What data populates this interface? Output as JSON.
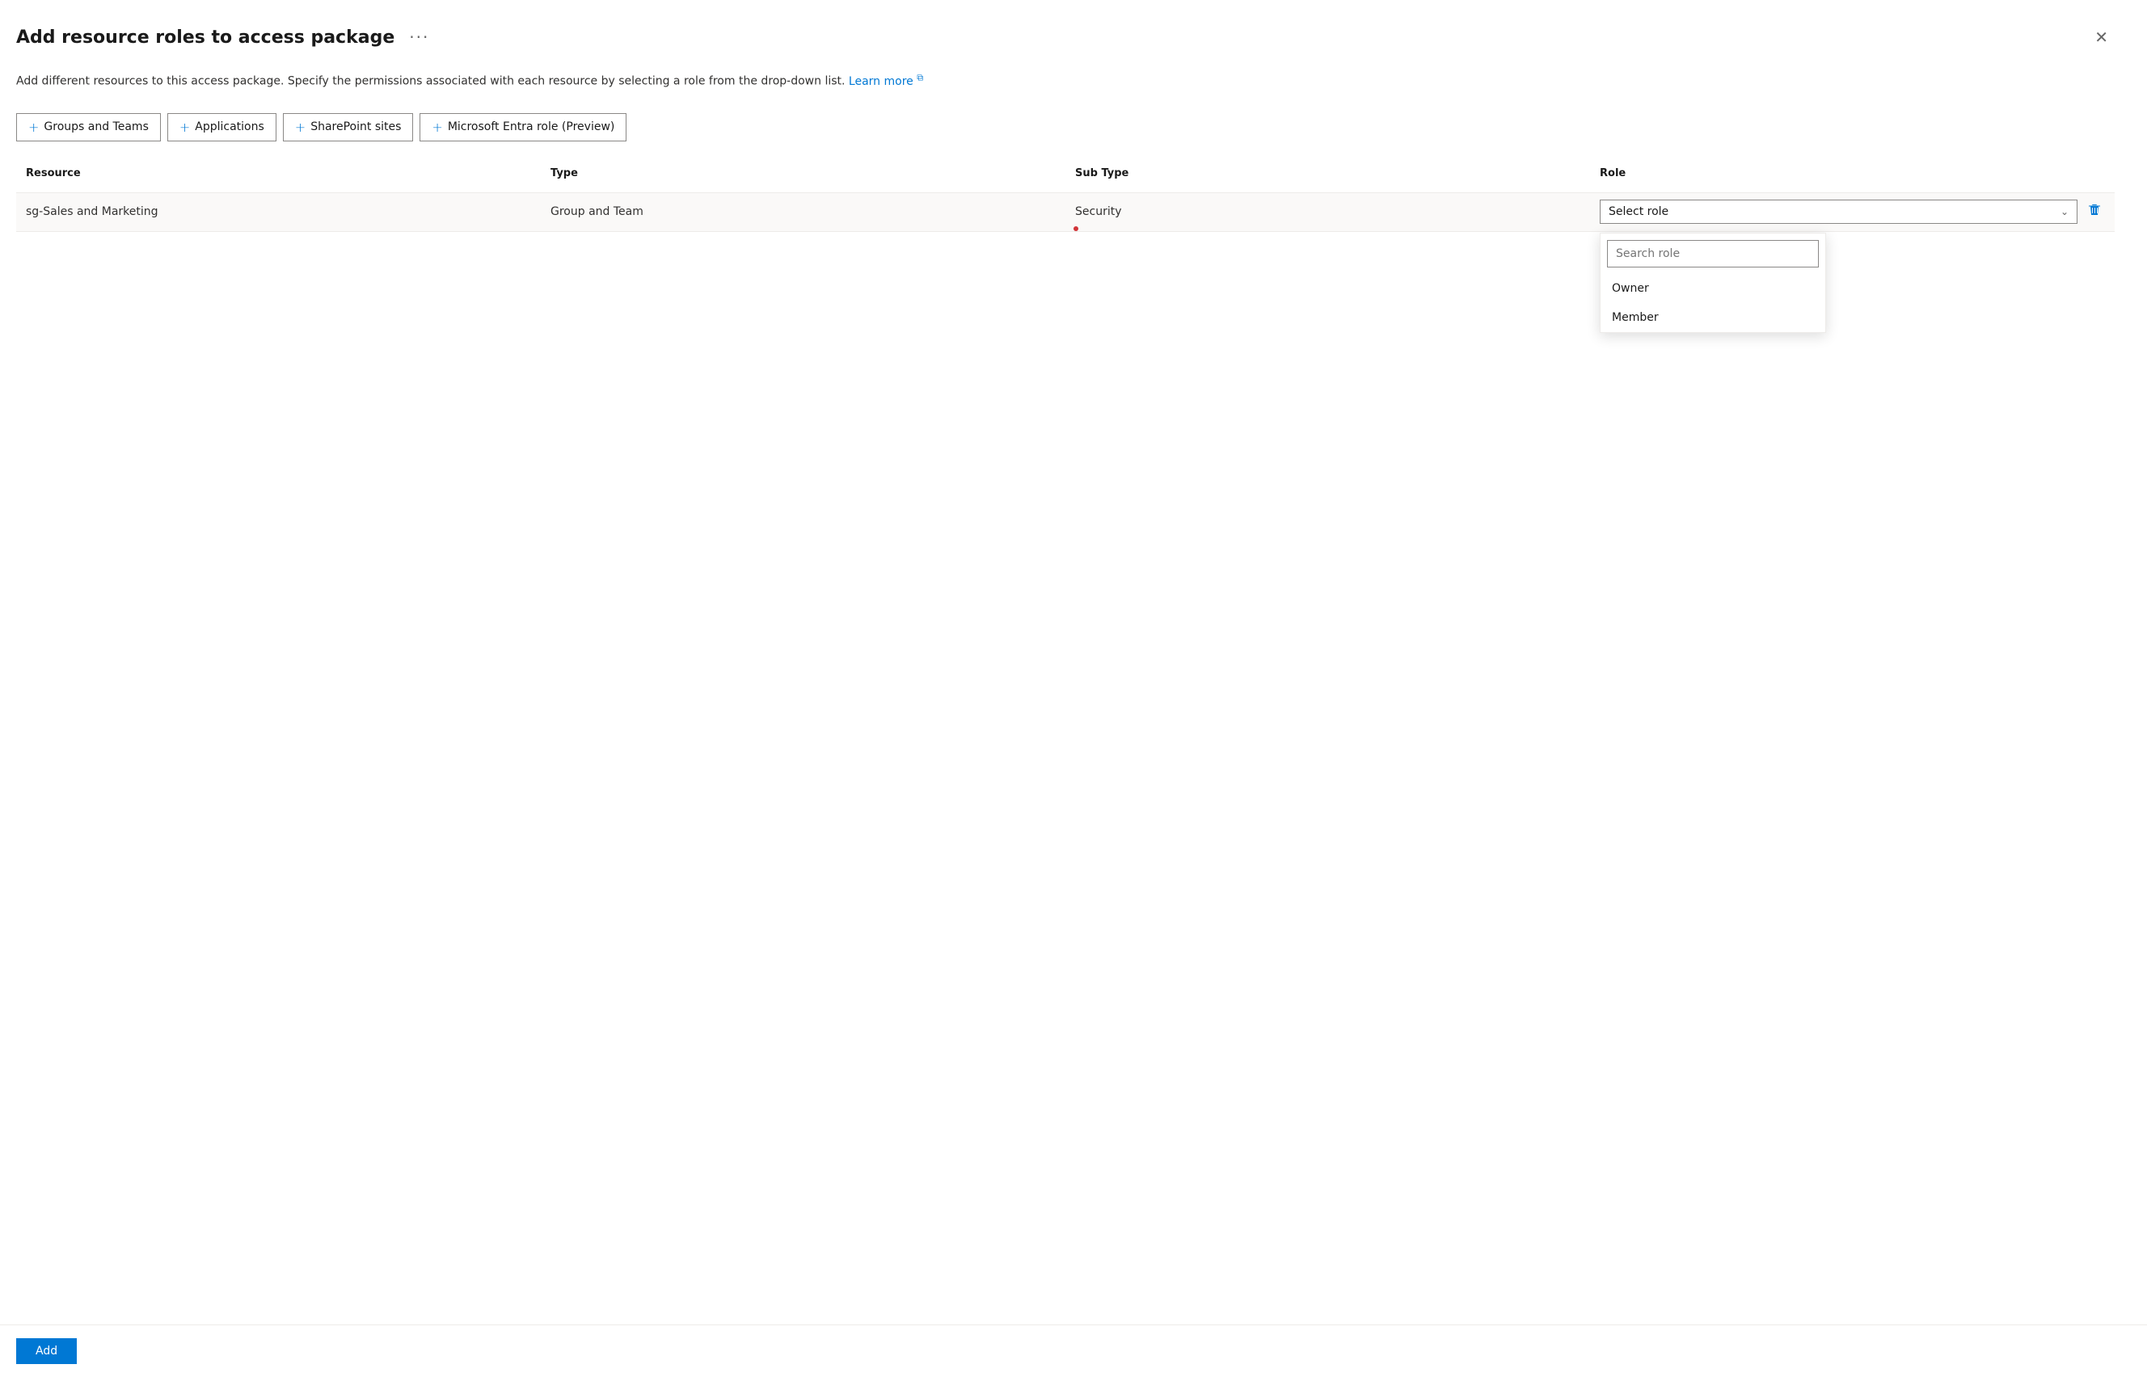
{
  "dialog": {
    "title": "Add resource roles to access package",
    "more_btn_label": "···",
    "close_btn_label": "✕",
    "description_text": "Add different resources to this access package. Specify the permissions associated with each resource by selecting a role from the drop-down list.",
    "learn_more_label": "Learn more",
    "external_icon": "↗"
  },
  "buttons": {
    "groups_teams": "+ Groups and Teams",
    "applications": "+ Applications",
    "sharepoint": "+ SharePoint sites",
    "entra": "+ Microsoft Entra role (Preview)"
  },
  "table": {
    "headers": {
      "resource": "Resource",
      "type": "Type",
      "sub_type": "Sub Type",
      "role": "Role"
    },
    "rows": [
      {
        "resource": "sg-Sales and Marketing",
        "type": "Group and Team",
        "sub_type": "Security",
        "role_placeholder": "Select role"
      }
    ]
  },
  "dropdown": {
    "search_placeholder": "Search role",
    "items": [
      {
        "label": "Owner"
      },
      {
        "label": "Member"
      }
    ]
  },
  "footer": {
    "add_label": "Add"
  }
}
